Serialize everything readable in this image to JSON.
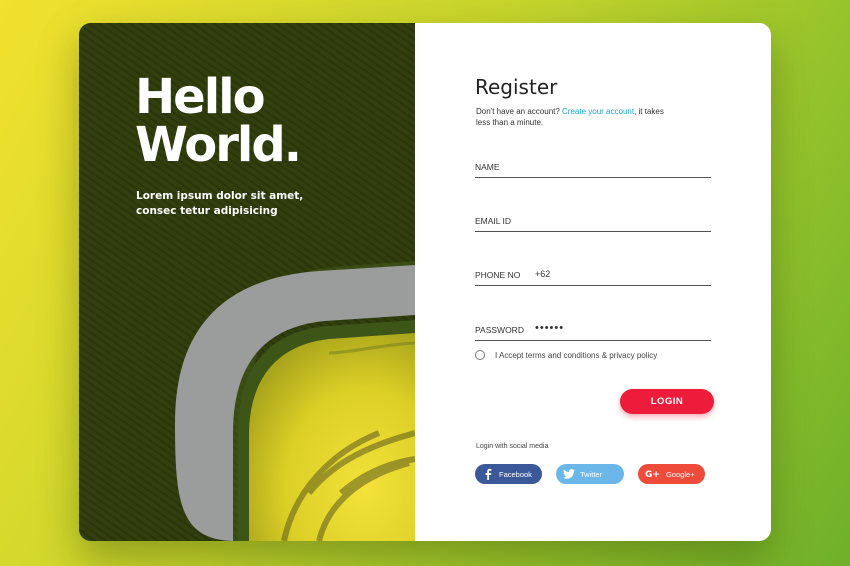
{
  "hero": {
    "title_line1": "Hello",
    "title_line2": "World.",
    "subtitle": "Lorem ipsum dolor sit amet, consec tetur adipisicing"
  },
  "register": {
    "title": "Register",
    "desc_prefix": "Don't have an account? ",
    "desc_link": "Create your account",
    "desc_suffix": ", it takes less than a minute."
  },
  "fields": {
    "name_label": "NAME",
    "email_label": "EMAIL ID",
    "phone_label": "PHONE NO",
    "phone_prefix": "+62",
    "password_label": "PASSWORD",
    "password_value": "••••••"
  },
  "terms": {
    "label": "I Accept terms and conditions & privacy policy"
  },
  "login": {
    "label": "LOGIN"
  },
  "social": {
    "caption": "Login with social media",
    "facebook": "Facebook",
    "twitter": "Twitter",
    "google": "Google+"
  },
  "colors": {
    "login": "#ed1c3a",
    "facebook": "#3b5998",
    "twitter": "#6bb7ea",
    "google": "#ee4b3a",
    "link": "#1aa3e0"
  },
  "icons": [
    "facebook-icon",
    "twitter-icon",
    "google-plus-icon",
    "radio-icon"
  ]
}
